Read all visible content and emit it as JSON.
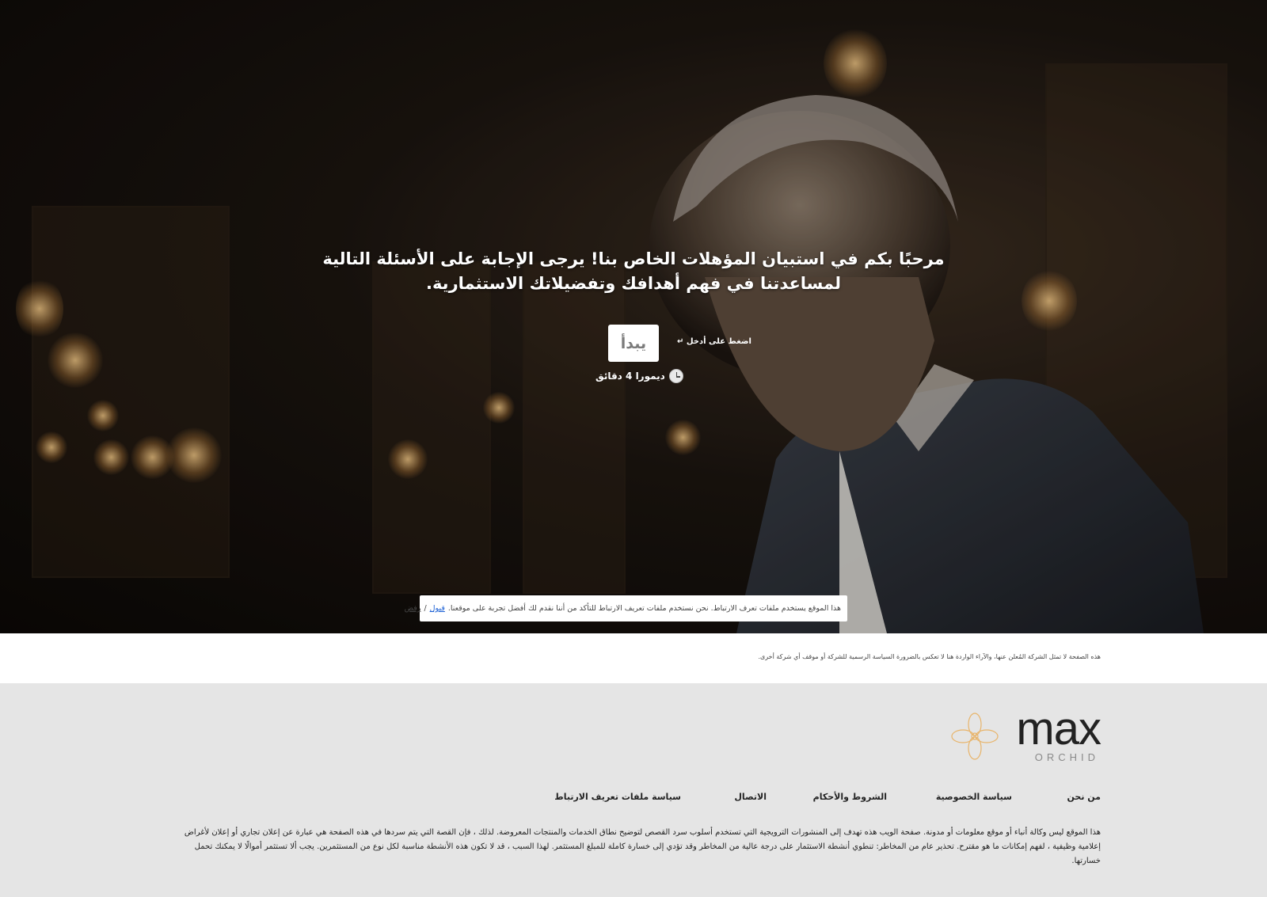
{
  "hero": {
    "headline": "مرحبًا بكم في استبيان المؤهلات الخاص بنا! يرجى الإجابة على الأسئلة التالية لمساعدتنا في فهم أهدافك وتفضيلاتك الاستثمارية.",
    "start_label": "يبدأ",
    "enter_hint": "اضغط على أدخل ↵",
    "time_label": "ديمورا 4 دقائق",
    "clock_icon": "clock-icon"
  },
  "cookie": {
    "text": "هذا الموقع يستخدم ملفات تعرف الارتباط. نحن نستخدم ملفات تعريف الارتباط للتأكد من أننا نقدم لك أفضل تجربة على موقعنا.",
    "accept_label": "قبول",
    "separator": "/",
    "reject_label": "رفض"
  },
  "disclaimer": "هذه الصفحة لا تمثل الشركة المُعلن عنها، والآراء الواردة هنا لا تعكس بالضرورة السياسة الرسمية للشركة أو موقف أي شركة أخرى.",
  "footer": {
    "logo_max": "max",
    "logo_orchid": "ORCHID",
    "logo_icon": "orchid-flower-icon",
    "nav": [
      {
        "label": "من نحن"
      },
      {
        "label": "سياسة الخصوصية"
      },
      {
        "label": "الشروط والأحكام"
      },
      {
        "label": "الاتصال"
      },
      {
        "label": "سياسة ملفات تعريف الارتباط"
      }
    ],
    "legal": "هذا الموقع ليس وكالة أنباء أو موقع معلومات أو مدونة. صفحة الويب هذه تهدف إلى المنشورات الترويجية التي تستخدم أسلوب سرد القصص لتوضيح نطاق الخدمات والمنتجات المعروضة. لذلك ، فإن القصة التي يتم سردها في هذه الصفحة هي عبارة عن إعلان تجاري أو إعلان لأغراض إعلامية وظيفية ، لفهم إمكانات ما هو مقترح. تحذير عام من المخاطر: تنطوي أنشطة الاستثمار على درجة عالية من المخاطر وقد تؤدي إلى خسارة كاملة للمبلغ المستثمر. لهذا السبب ، قد لا تكون هذه الأنشطة مناسبة لكل نوع من المستثمرين. يجب ألا تستثمر أموالًا لا يمكنك تحمل خسارتها."
  },
  "colors": {
    "hero_dark": "#0b0806",
    "footer_bg": "#e5e5e5",
    "link_blue": "#1a5fd4",
    "logo_accent": "#e8b46a"
  }
}
